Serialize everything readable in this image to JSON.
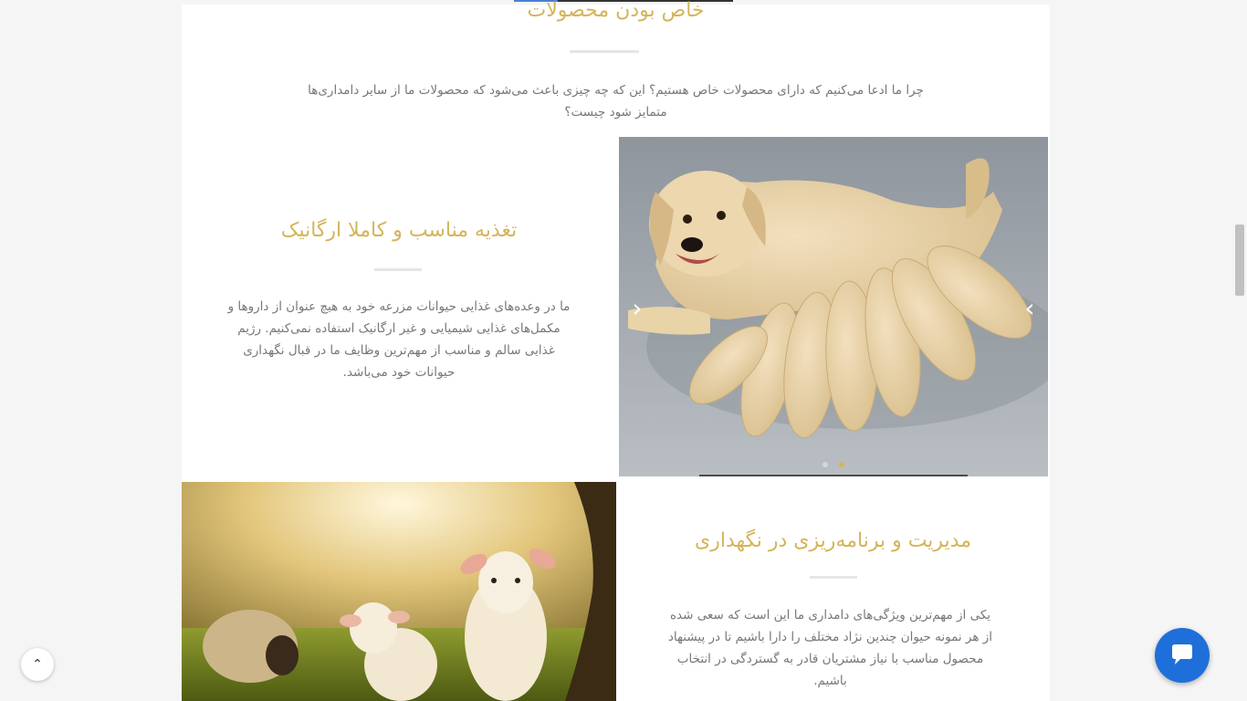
{
  "intro": {
    "title": "خاص بودن محصولات",
    "text": "چرا ما ادعا می‌کنیم که دارای محصولات خاص هستیم؟ این که چه چیزی باعث می‌شود که محصولات ما از سایر دامداری‌ها متمایز شود چیست؟"
  },
  "feature1": {
    "title": "تغذیه مناسب و کاملا ارگانیک",
    "text": "ما در وعده‌های غذایی حیوانات مزرعه خود به هیچ عنوان از داروها و مکمل‌های غذایی شیمیایی و غیر ارگانیک استفاده نمی‌کنیم. رژیم غذایی سالم و مناسب از مهم‌ترین وظایف ما در قبال نگهداری حیوانات خود می‌باشد."
  },
  "feature2": {
    "title": "مدیریت و برنامه‌ریزی در نگهداری",
    "text": "یکی از مهم‌ترین ویژگی‌های دامداری ما این است که سعی شده از هر نمونه حیوان چندین نژاد مختلف را دارا باشیم تا در پیشنهاد محصول مناسب با نیاز مشتریان قادر به گستردگی در انتخاب باشیم."
  },
  "slider": {
    "prev_icon": "chevron-left-icon",
    "next_icon": "chevron-right-icon",
    "prev_glyph": "‹",
    "next_glyph": "›",
    "slide_count": 2,
    "active_slide": 2
  },
  "floating": {
    "to_top_icon": "chevron-up-icon",
    "to_top_glyph": "⌃",
    "chat_icon": "chat-bubble-icon"
  },
  "colors": {
    "accent": "#d4b45a",
    "chat": "#1e6fd9"
  }
}
